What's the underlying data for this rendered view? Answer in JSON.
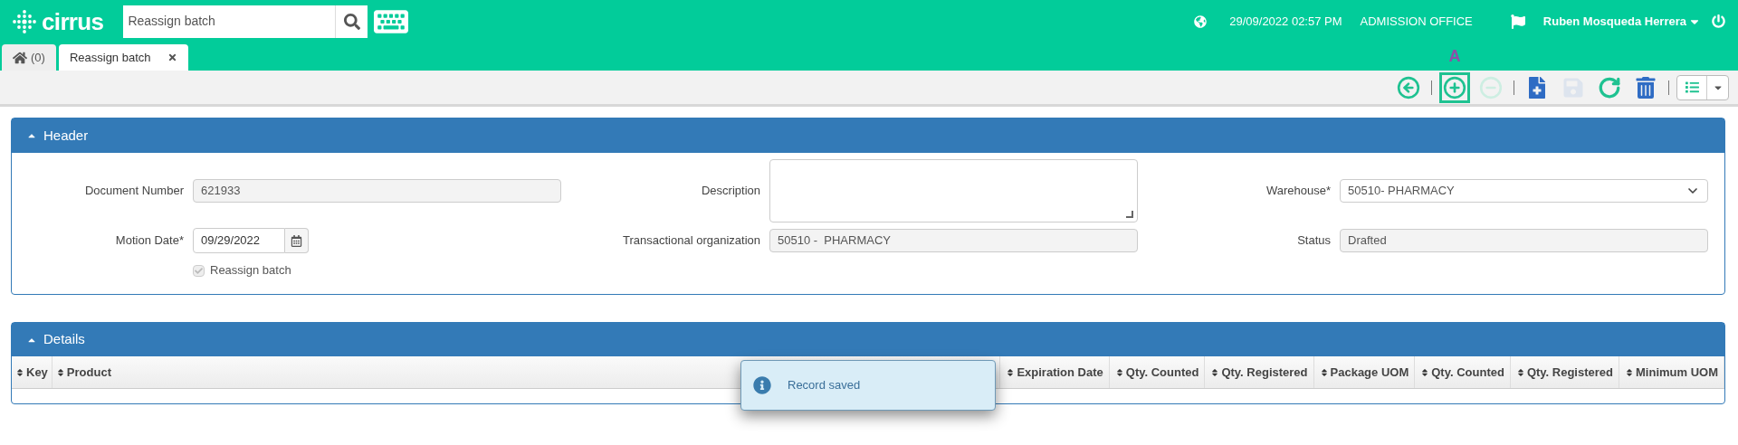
{
  "topbar": {
    "logo": "cirrus",
    "search": {
      "value": "Reassign batch"
    },
    "datetime": "29/09/2022 02:57 PM",
    "location": "ADMISSION OFFICE",
    "user": "Ruben Mosqueda Herrera"
  },
  "tabs": [
    {
      "kind": "home",
      "label": "(0)",
      "selected": false
    },
    {
      "kind": "page",
      "label": "Reassign batch",
      "selected": true
    }
  ],
  "toolbar": [
    {
      "kind": "back",
      "disabled": false
    },
    {
      "kind": "separator"
    },
    {
      "kind": "add",
      "disabled": false,
      "highlighted": true,
      "annotation": "A"
    },
    {
      "kind": "remove",
      "disabled": true
    },
    {
      "kind": "separator"
    },
    {
      "kind": "new",
      "disabled": false
    },
    {
      "kind": "save",
      "disabled": true
    },
    {
      "kind": "refresh",
      "disabled": false
    },
    {
      "kind": "delete",
      "disabled": false
    },
    {
      "kind": "separator"
    },
    {
      "kind": "list",
      "disabled": false
    }
  ],
  "header": {
    "title": "Header",
    "expanded": true,
    "columns": [
      {
        "fields": [
          {
            "kind": "text",
            "label": "Document Number",
            "value": "621933",
            "disabled": true
          },
          {
            "kind": "date",
            "label": "Motion Date*",
            "value": "09/29/2022",
            "disabled": false
          },
          {
            "kind": "checkbox",
            "label": "Reassign batch",
            "checked": true,
            "disabled": true
          }
        ]
      },
      {
        "fields": [
          {
            "kind": "textarea",
            "label": "Description",
            "disabled": false
          },
          {
            "kind": "text",
            "label": "Transactional organization",
            "value": "50510 -  PHARMACY",
            "disabled": true
          }
        ]
      },
      {
        "fields": [
          {
            "kind": "select",
            "label": "Warehouse*",
            "value": "50510- PHARMACY",
            "disabled": false
          },
          {
            "kind": "text",
            "label": "Status",
            "value": "Drafted",
            "disabled": true
          }
        ]
      }
    ]
  },
  "details": {
    "title": "Details",
    "expanded": true,
    "columns": [
      "Key",
      "Product",
      "Expiration Date",
      "Qty. Counted",
      "Qty. Registered",
      "Package UOM",
      "Qty. Counted",
      "Qty. Registered",
      "Minimum UOM"
    ]
  },
  "toast": {
    "message": "Record saved"
  }
}
